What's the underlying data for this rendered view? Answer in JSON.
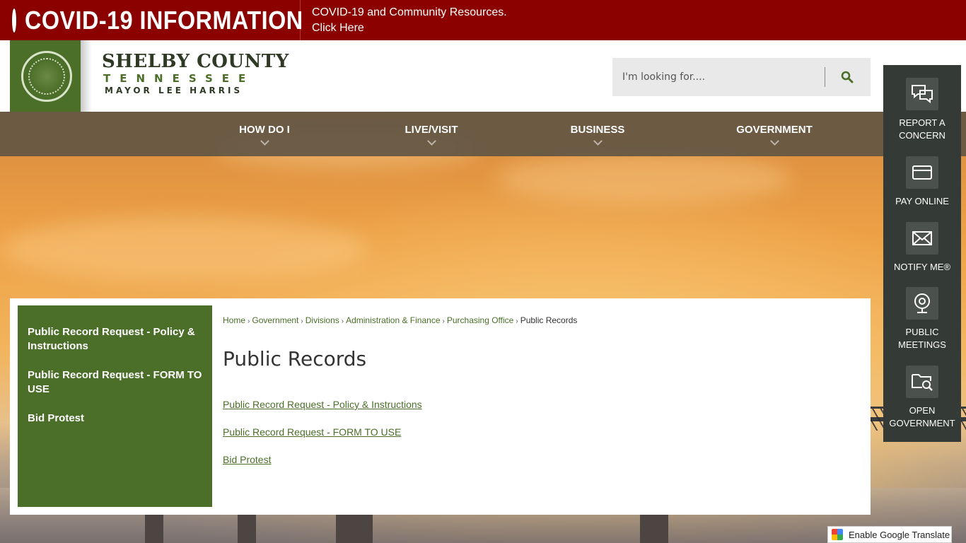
{
  "covid": {
    "title": "COVID-19 INFORMATION",
    "message_line1": "COVID-19 and Community Resources.",
    "message_line2": "Click Here"
  },
  "header": {
    "brand_name": "SHELBY COUNTY",
    "brand_state": "TENNESSEE",
    "brand_mayor": "MAYOR LEE HARRIS",
    "search_placeholder": "I'm looking for...."
  },
  "nav": {
    "items": [
      {
        "label": "HOW DO I"
      },
      {
        "label": "LIVE/VISIT"
      },
      {
        "label": "BUSINESS"
      },
      {
        "label": "GOVERNMENT"
      }
    ]
  },
  "quick_links": [
    {
      "label": "REPORT A CONCERN",
      "icon": "chat-bubbles-icon"
    },
    {
      "label": "PAY ONLINE",
      "icon": "credit-card-icon"
    },
    {
      "label": "NOTIFY ME®",
      "icon": "envelope-icon"
    },
    {
      "label": "PUBLIC MEETINGS",
      "icon": "webcam-icon"
    },
    {
      "label": "OPEN GOVERNMENT",
      "icon": "folder-search-icon"
    }
  ],
  "sidebar": {
    "links": [
      {
        "label": "Public Record Request - Policy & Instructions"
      },
      {
        "label": "Public Record Request - FORM TO USE"
      },
      {
        "label": "Bid Protest"
      }
    ]
  },
  "breadcrumb": {
    "items": [
      {
        "label": "Home"
      },
      {
        "label": "Government"
      },
      {
        "label": "Divisions"
      },
      {
        "label": "Administration & Finance"
      },
      {
        "label": "Purchasing Office"
      }
    ],
    "current": "Public Records"
  },
  "page": {
    "title": "Public Records",
    "links": [
      {
        "label": "Public Record Request - Policy & Instructions"
      },
      {
        "label": "Public Record Request - FORM TO USE"
      },
      {
        "label": "Bid Protest"
      }
    ]
  },
  "translate": {
    "label": "Enable Google Translate"
  },
  "colors": {
    "covid_red": "#8b0100",
    "brand_green": "#4b6e28",
    "nav_brown": "#5f5444",
    "quick_dark": "#343a36"
  }
}
